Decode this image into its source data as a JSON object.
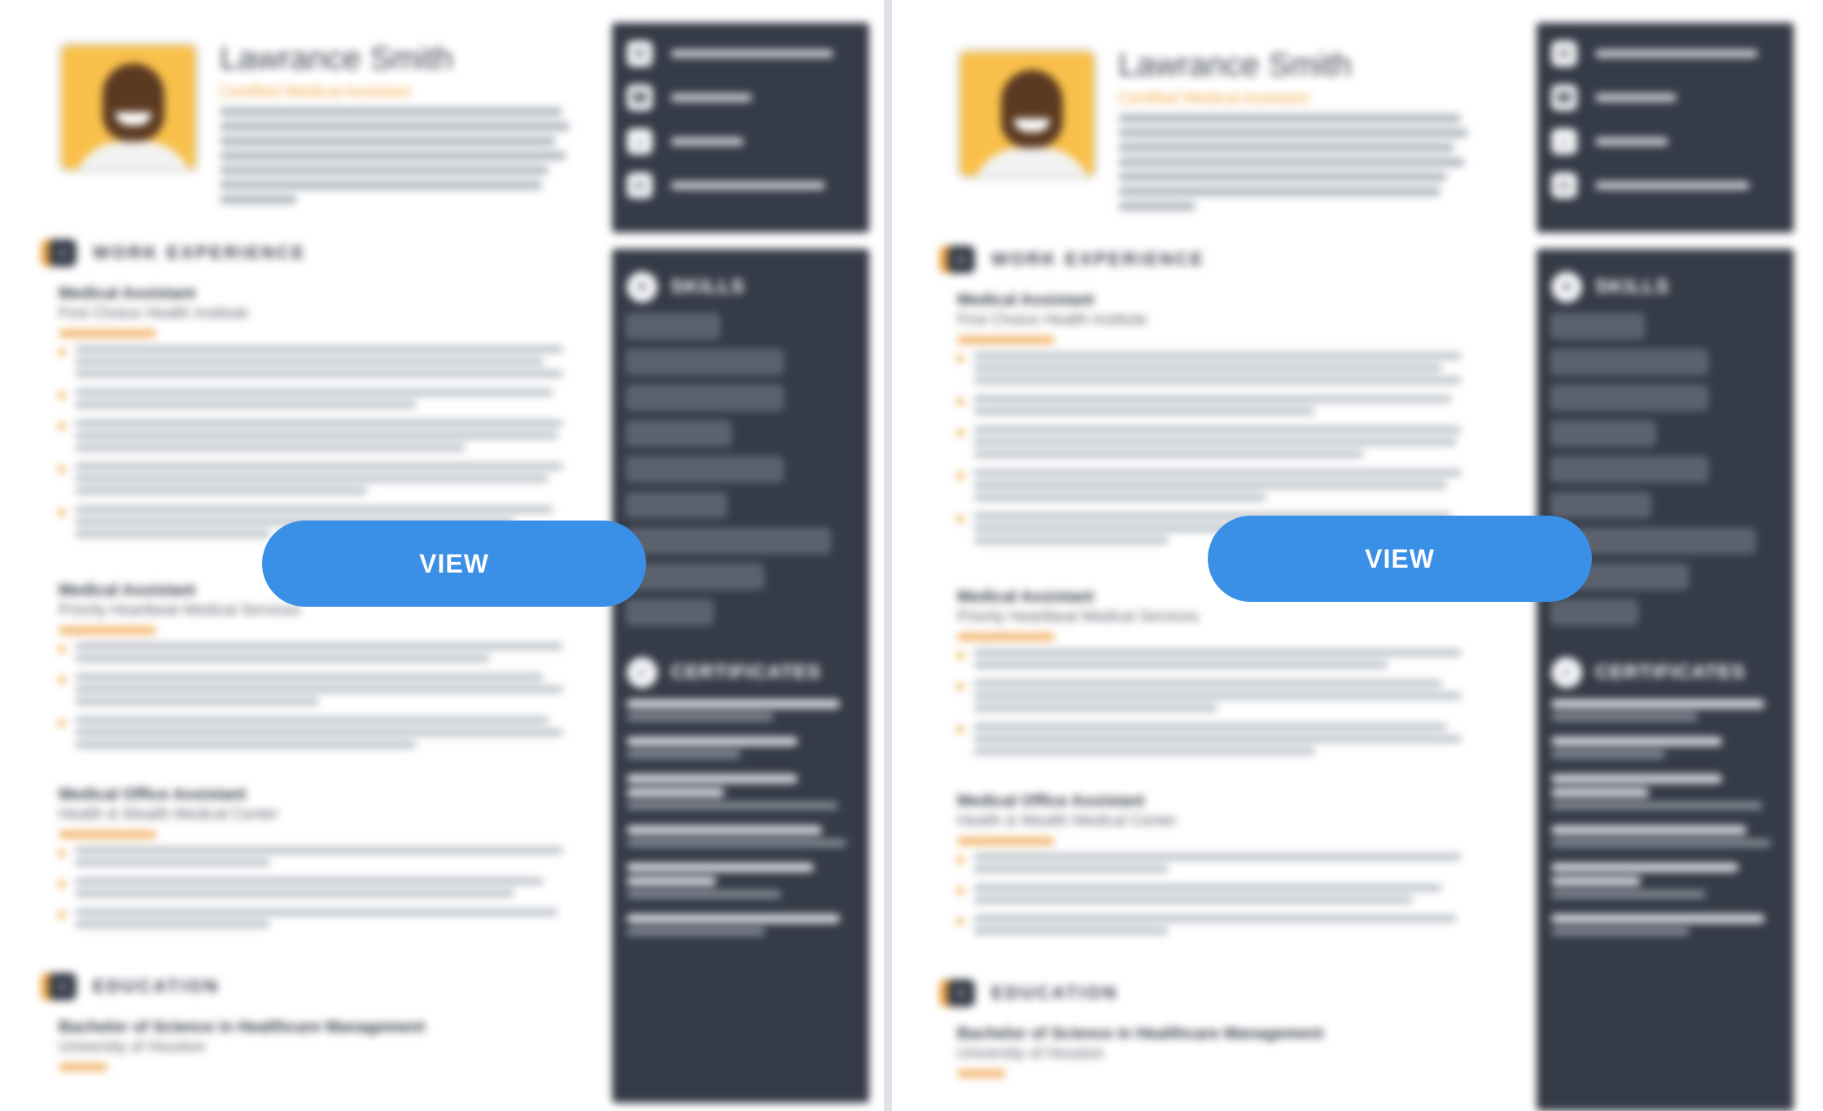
{
  "buttons": {
    "view_left": "VIEW",
    "view_right": "VIEW"
  },
  "resume": {
    "name": "Lawrance Smith",
    "role": "Certified Medical Assistant",
    "sections": {
      "work": "WORK EXPERIENCE",
      "education": "EDUCATION",
      "skills": "SKILLS",
      "certificates": "CERTIFICATES"
    },
    "jobs": [
      {
        "title": "Medical Assistant",
        "org": "First Choice Health Institute"
      },
      {
        "title": "Medical Assistant",
        "org": "Priority Heartbeat Medical Services"
      },
      {
        "title": "Medical Office Assistant",
        "org": "Health & Wealth Medical Center"
      }
    ],
    "education": {
      "degree": "Bachelor of Science in Healthcare Management",
      "school": "University of Houston"
    }
  },
  "colors": {
    "accent": "#f0a640",
    "sidebar": "#353b47",
    "button": "#3a8fe6"
  }
}
